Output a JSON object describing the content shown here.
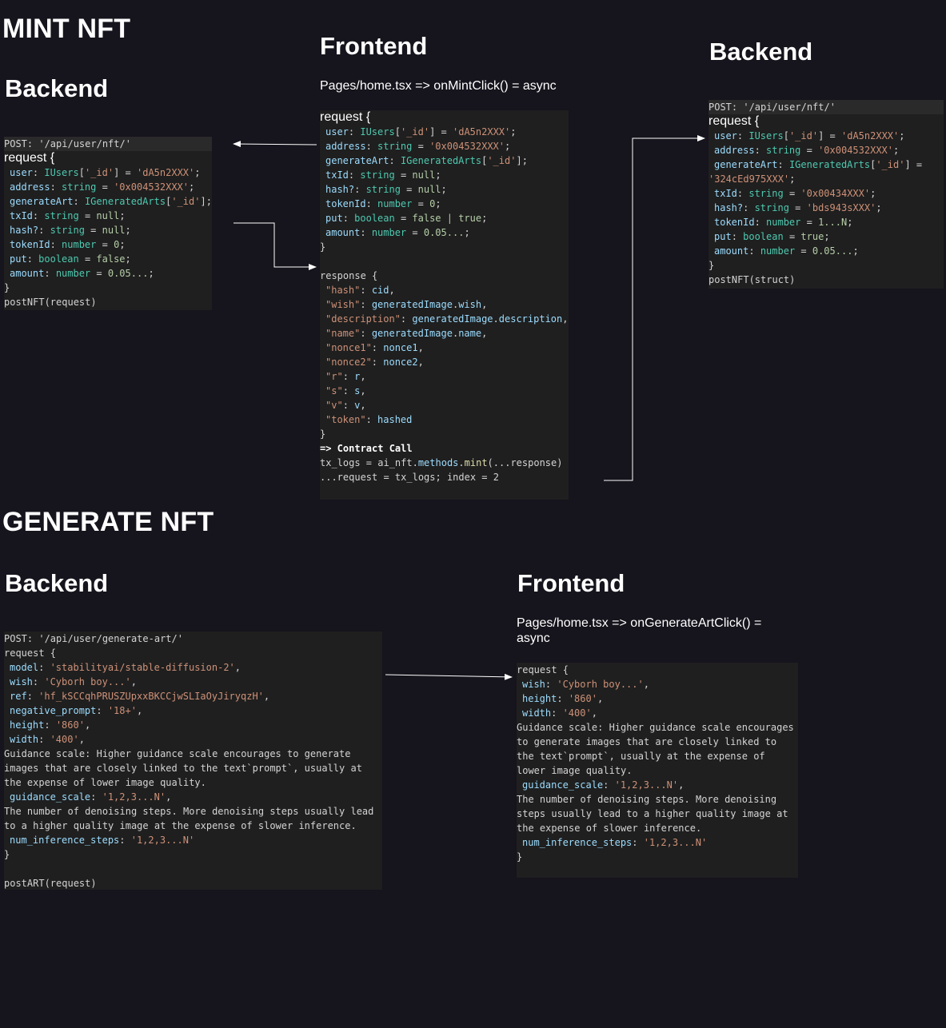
{
  "mint_section": {
    "title": "MINT NFT",
    "backend_heading": "Backend",
    "frontend_heading": "Frontend",
    "backend2_heading": "Backend",
    "frontend_signature": "Pages/home.tsx => onMintClick() = async",
    "backend_left": {
      "post": "POST: '/api/user/nft/'",
      "request_open": "request {",
      "fields": [
        {
          "key": "user",
          "type": "IUsers",
          "sep": ": ",
          "idx": "['_id']",
          "eq": " = ",
          "val": "'dA5n2XXX'",
          "end": ";"
        },
        {
          "key": "address",
          "sep": ": ",
          "type": "string",
          "eq": " = ",
          "val": "'0x004532XXX'",
          "end": ";"
        },
        {
          "key": "generateArt",
          "sep": ": ",
          "type": "IGeneratedArts",
          "idx": "['_id']",
          "end": ";"
        },
        {
          "key": "txId",
          "sep": ": ",
          "type": "string",
          "eq": " = ",
          "val": "null",
          "end": ";"
        },
        {
          "key": "hash?",
          "sep": ": ",
          "type": "string",
          "eq": " = ",
          "val": "null",
          "end": ";"
        },
        {
          "key": "tokenId",
          "sep": ": ",
          "type": "number",
          "eq": " = ",
          "val": "0",
          "end": ";"
        },
        {
          "key": "put",
          "sep": ": ",
          "type": "boolean",
          "eq": " = ",
          "val": "false",
          "end": ";"
        },
        {
          "key": "amount",
          "sep": ": ",
          "type": "number",
          "eq": " = ",
          "val": "0.05...",
          "end": ";"
        }
      ],
      "close": "}",
      "call": "postNFT(request)"
    },
    "frontend_request": {
      "request_open": "request {",
      "fields": [
        {
          "key": "user",
          "type": "IUsers",
          "idx": "['_id']",
          "eq": " = ",
          "val": "'dA5n2XXX'",
          "end": ";"
        },
        {
          "key": "address",
          "type": "string",
          "eq": " = ",
          "val": "'0x004532XXX'",
          "end": ";"
        },
        {
          "key": "generateArt",
          "type": "IGeneratedArts",
          "idx": "['_id']",
          "end": ";"
        },
        {
          "key": "txId",
          "type": "string",
          "eq": " = ",
          "val": "null",
          "end": ";"
        },
        {
          "key": "hash?",
          "type": "string",
          "eq": " = ",
          "val": "null",
          "end": ";"
        },
        {
          "key": "tokenId",
          "type": "number",
          "eq": " = ",
          "val": "0",
          "end": ";"
        },
        {
          "key": "put",
          "type": "boolean",
          "eq": " = ",
          "val": "false | true",
          "end": ";"
        },
        {
          "key": "amount",
          "type": "number",
          "eq": " = ",
          "val": "0.05...",
          "end": ";"
        }
      ],
      "close": "}",
      "response_open": "response {",
      "response_fields": [
        {
          "key": "\"hash\"",
          "val": "cid"
        },
        {
          "key": "\"wish\"",
          "val": "generatedImage.wish"
        },
        {
          "key": "\"description\"",
          "val": "generatedImage.description"
        },
        {
          "key": "\"name\"",
          "val": "generatedImage.name"
        },
        {
          "key": "\"nonce1\"",
          "val": "nonce1"
        },
        {
          "key": "\"nonce2\"",
          "val": "nonce2"
        },
        {
          "key": "\"r\"",
          "val": "r"
        },
        {
          "key": "\"s\"",
          "val": "s"
        },
        {
          "key": "\"v\"",
          "val": "v"
        },
        {
          "key": "\"token\"",
          "val": "hashed"
        }
      ],
      "response_close": "}",
      "contract_call": "=> Contract Call",
      "tx_line": "tx_logs = ai_nft.methods.mint(...response)",
      "request_line": "...request = tx_logs; index = 2"
    },
    "backend_right": {
      "post": "POST: '/api/user/nft/'",
      "request_open": "request {",
      "lines": [
        {
          "key": "user",
          "type": "IUsers",
          "idx": "['_id']",
          "eq": " = ",
          "val": "'dA5n2XXX'",
          "end": ";"
        },
        {
          "key": "address",
          "type": "string",
          "eq": " = ",
          "val": "'0x004532XXX'",
          "end": ";"
        },
        {
          "key": "generateArt",
          "type": "IGeneratedArts",
          "idx": "['_id']",
          "eq": " = "
        },
        {
          "key": "",
          "val": "'324cEd975XXX'",
          "end": ";",
          "noindent": true
        },
        {
          "key": "txId",
          "type": "string",
          "eq": " = ",
          "val": "'0x00434XXX'",
          "end": ";"
        },
        {
          "key": "hash?",
          "type": "string",
          "eq": " = ",
          "val": "'bds943sXXX'",
          "end": ";"
        },
        {
          "key": "tokenId",
          "type": "number",
          "eq": " = ",
          "val": "1...N",
          "end": ";"
        },
        {
          "key": "put",
          "type": "boolean",
          "eq": " = ",
          "val": "true",
          "end": ";"
        },
        {
          "key": "amount",
          "type": "number",
          "eq": " = ",
          "val": "0.05...",
          "end": ";"
        }
      ],
      "close": "}",
      "call": "postNFT(struct)"
    }
  },
  "generate_section": {
    "title": "GENERATE NFT",
    "backend_heading": "Backend",
    "frontend_heading": "Frontend",
    "frontend_signature": "Pages/home.tsx => onGenerateArtClick() = async",
    "backend": {
      "post": "POST: '/api/user/generate-art/'",
      "request_open": "request {",
      "lines": [
        {
          "key": "model",
          "val": "'stabilityai/stable-diffusion-2'",
          "end": ","
        },
        {
          "key": "wish",
          "val": "'Cyborh boy...'",
          "end": ","
        },
        {
          "key": "ref",
          "val": "'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'",
          "end": ","
        },
        {
          "key": "negative_prompt",
          "val": "'18+'",
          "end": ","
        },
        {
          "key": "height",
          "val": "'860'",
          "end": ","
        },
        {
          "key": "width",
          "val": "'400'",
          "end": ","
        }
      ],
      "guidance_note": [
        "Guidance scale: Higher guidance scale encourages to generate",
        "images that are closely linked to the text`prompt`, usually at",
        "the expense of lower image quality."
      ],
      "guidance_field": {
        "key": "guidance_scale",
        "val": "'1,2,3...N'",
        "end": ","
      },
      "steps_note": [
        "The number of denoising steps. More denoising steps usually lead",
        "to a higher quality image at the expense of slower inference."
      ],
      "steps_field": {
        "key": "num_inference_steps",
        "val": "'1,2,3...N'"
      },
      "close": "}",
      "call": "postART(request)"
    },
    "frontend": {
      "request_open": "request {",
      "lines": [
        {
          "key": "wish",
          "val": "'Cyborh boy...'",
          "end": ","
        },
        {
          "key": "height",
          "val": "'860'",
          "end": ","
        },
        {
          "key": "width",
          "val": "'400'",
          "end": ","
        }
      ],
      "guidance_note": [
        "Guidance scale: Higher guidance scale encourages",
        "to generate images that are closely linked to",
        "the text`prompt`, usually at the expense of",
        "lower image quality."
      ],
      "guidance_field": {
        "key": "guidance_scale",
        "val": "'1,2,3...N'",
        "end": ","
      },
      "steps_note": [
        "The number of denoising steps. More denoising",
        "steps usually lead to a higher quality image at",
        "the expense of slower inference."
      ],
      "steps_field": {
        "key": "num_inference_steps",
        "val": "'1,2,3...N'"
      },
      "close": "}"
    }
  }
}
